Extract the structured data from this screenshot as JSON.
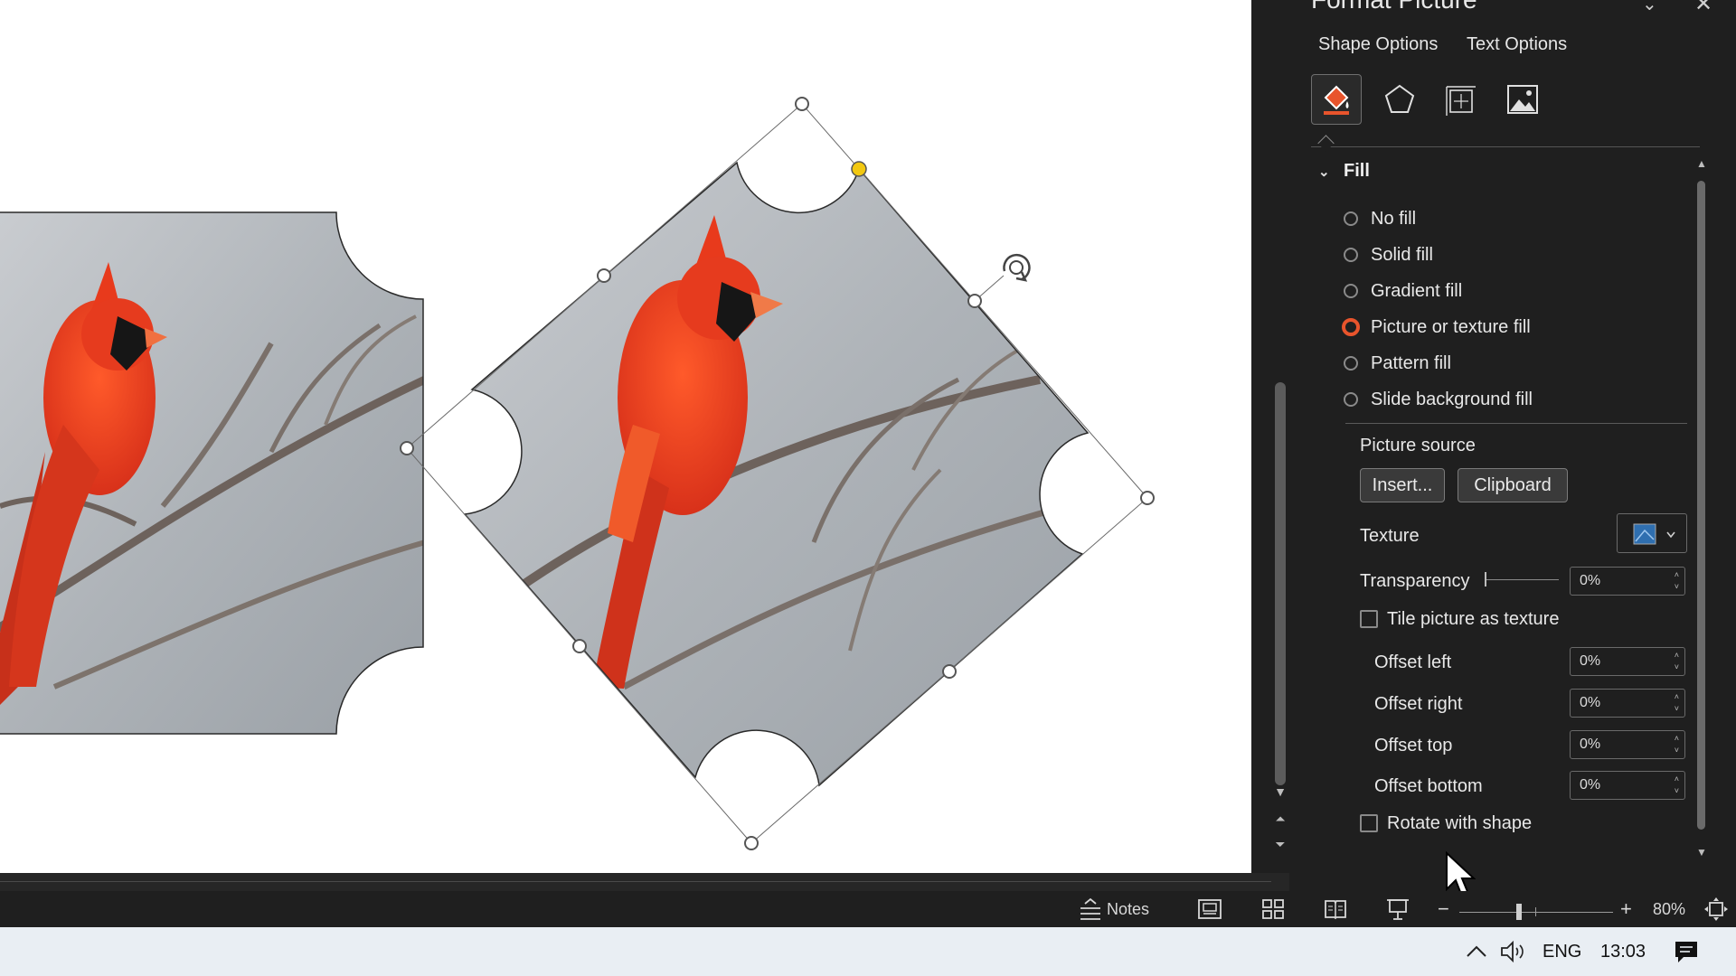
{
  "pane": {
    "title": "Format Picture",
    "tabs": [
      "Shape Options",
      "Text Options"
    ],
    "category_icons": [
      "fill-line-icon",
      "effects-pentagon-icon",
      "size-properties-icon",
      "picture-icon"
    ],
    "section": "Fill",
    "fill_options": [
      {
        "label": "No fill",
        "selected": false
      },
      {
        "label": "Solid fill",
        "selected": false
      },
      {
        "label": "Gradient fill",
        "selected": false
      },
      {
        "label": "Picture or texture fill",
        "selected": true
      },
      {
        "label": "Pattern fill",
        "selected": false
      },
      {
        "label": "Slide background fill",
        "selected": false
      }
    ],
    "picture_source_label": "Picture source",
    "insert_button": "Insert...",
    "clipboard_button": "Clipboard",
    "texture_label": "Texture",
    "transparency_label": "Transparency",
    "transparency_value": "0%",
    "tile_label": "Tile picture as texture",
    "tile_checked": false,
    "offset_left_label": "Offset left",
    "offset_left_value": "0%",
    "offset_right_label": "Offset right",
    "offset_right_value": "0%",
    "offset_top_label": "Offset top",
    "offset_top_value": "0%",
    "offset_bottom_label": "Offset bottom",
    "offset_bottom_value": "0%",
    "rotate_label": "Rotate with shape",
    "rotate_checked": false
  },
  "statusbar": {
    "notes_label": "Notes",
    "zoom_minus": "−",
    "zoom_plus": "+",
    "zoom_level": "80%"
  },
  "taskbar": {
    "language": "ENG",
    "time": "13:03"
  },
  "colors": {
    "pane_bg": "#1f1f1f",
    "accent": "#e8542c",
    "adjust_handle": "#f2c811",
    "cardinal_red": "#e8341c"
  }
}
